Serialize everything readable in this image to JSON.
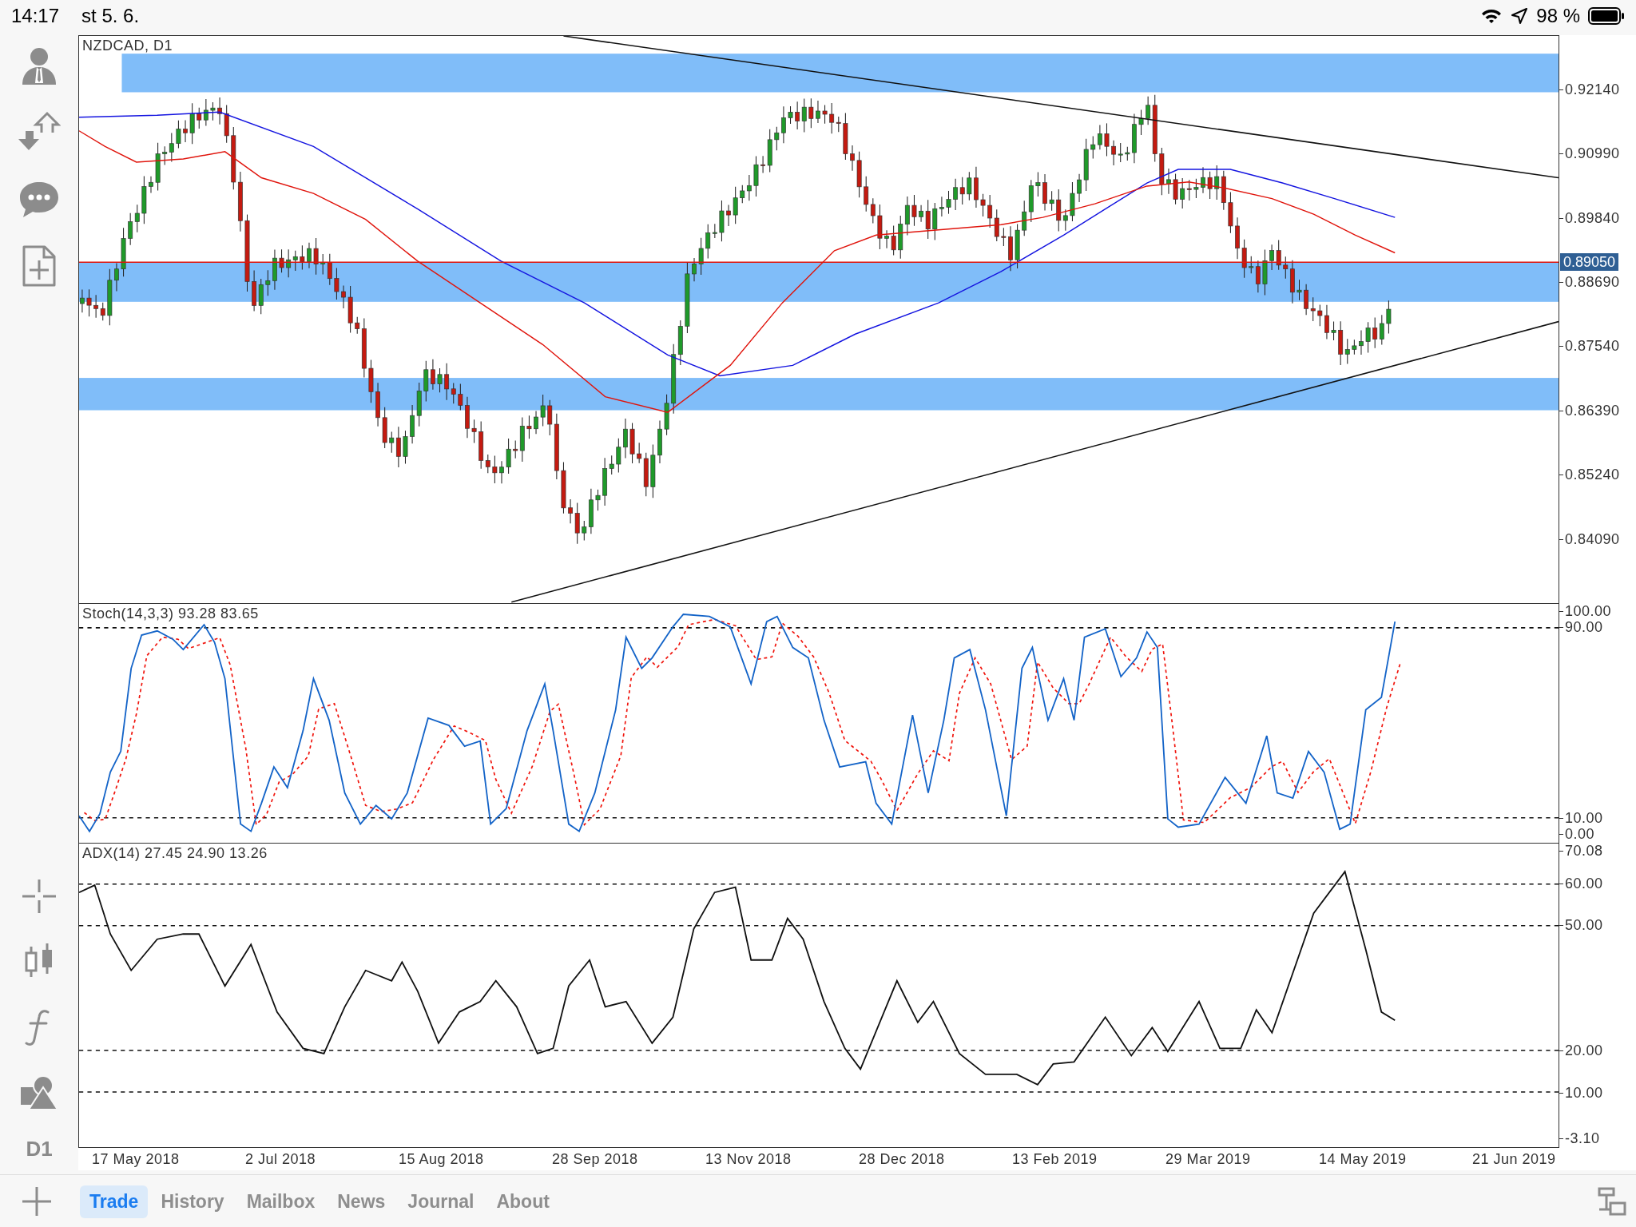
{
  "status_bar": {
    "time": "14:17",
    "date": "st 5. 6.",
    "battery": "98 %"
  },
  "toolbar": {
    "period": "D1"
  },
  "main_chart": {
    "title": "NZDCAD, D1",
    "price_axis": [
      "0.92140",
      "0.90990",
      "0.89840",
      "0.88690",
      "0.87540",
      "0.86390",
      "0.85240",
      "0.84090"
    ],
    "current_price": "0.89050"
  },
  "stochastic": {
    "title": "Stoch(14,3,3) 93.28 83.65",
    "axis": [
      "100.00",
      "90.00",
      "10.00",
      "0.00"
    ]
  },
  "adx": {
    "title": "ADX(14) 27.45 24.90 13.26",
    "axis": [
      "70.08",
      "60.00",
      "50.00",
      "20.00",
      "10.00",
      "-3.10"
    ]
  },
  "time_axis": [
    "17 May 2018",
    "2 Jul 2018",
    "15 Aug 2018",
    "28 Sep 2018",
    "13 Nov 2018",
    "28 Dec 2018",
    "13 Feb 2019",
    "29 Mar 2019",
    "14 May 2019",
    "21 Jun 2019"
  ],
  "tabs": [
    {
      "label": "Trade",
      "selected": true
    },
    {
      "label": "History",
      "selected": false
    },
    {
      "label": "Mailbox",
      "selected": false
    },
    {
      "label": "News",
      "selected": false
    },
    {
      "label": "Journal",
      "selected": false
    },
    {
      "label": "About",
      "selected": false
    }
  ]
}
